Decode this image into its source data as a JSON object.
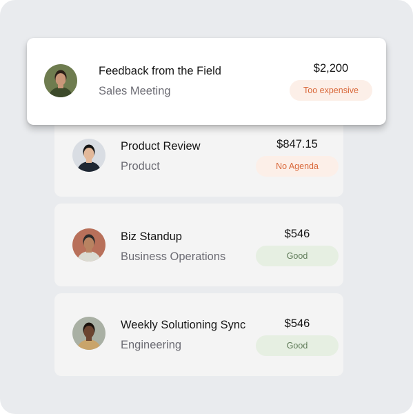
{
  "meetings": [
    {
      "title": "Feedback from the Field",
      "category": "Sales Meeting",
      "amount": "$2,200",
      "status": "Too expensive",
      "status_colors": {
        "bg": "#fcefe8",
        "fg": "#d9683a"
      },
      "avatar": {
        "skin": "#c99779",
        "hair": "#2b1f17",
        "bg": "#6e7c4f",
        "shirt": "#3c4a2a"
      }
    },
    {
      "title": "Product Review",
      "category": "Product",
      "amount": "$847.15",
      "status": "No Agenda",
      "status_colors": {
        "bg": "#fcefe8",
        "fg": "#d9683a"
      },
      "avatar": {
        "skin": "#e2b89a",
        "hair": "#141414",
        "bg": "#d9dde3",
        "shirt": "#1f2733"
      }
    },
    {
      "title": "Biz Standup",
      "category": "Business Operations",
      "amount": "$546",
      "status": "Good",
      "status_colors": {
        "bg": "#e6efe2",
        "fg": "#5e7a57"
      },
      "avatar": {
        "skin": "#b88361",
        "hair": "#2a2a2a",
        "bg": "#b8705a",
        "shirt": "#dbdbd2"
      }
    },
    {
      "title": "Weekly Solutioning Sync",
      "category": "Engineering",
      "amount": "$546",
      "status": "Good",
      "status_colors": {
        "bg": "#e6efe2",
        "fg": "#5e7a57"
      },
      "avatar": {
        "skin": "#6b4430",
        "hair": "#1b120d",
        "bg": "#a9b0a4",
        "shirt": "#c9a46a"
      }
    }
  ]
}
